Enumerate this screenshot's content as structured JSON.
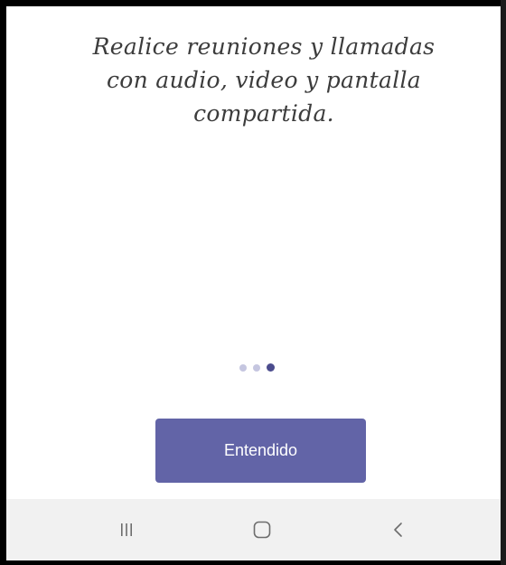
{
  "onboarding": {
    "headline": "Realice reuniones y llamadas\ncon audio, video y pantalla\ncompartida.",
    "pager": {
      "total": 3,
      "current_index": 2
    },
    "primary_button_label": "Entendido"
  },
  "navbar": {
    "icons": [
      "recents-icon",
      "home-icon",
      "back-icon"
    ]
  },
  "colors": {
    "accent": "#6264a7",
    "dot_active": "#4b4c8d",
    "dot_inactive": "#c5c6e0",
    "navbar_bg": "#f1f1f1",
    "text": "#3c3c3c"
  }
}
